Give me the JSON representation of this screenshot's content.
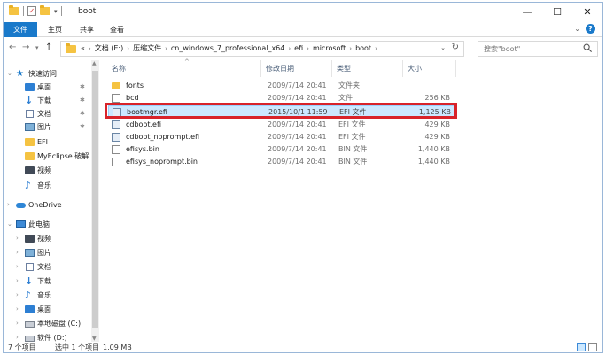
{
  "window": {
    "title": "boot",
    "controls": {
      "minimize": "—",
      "maximize": "☐",
      "close": "✕"
    }
  },
  "ribbon": {
    "tabs": [
      "文件",
      "主页",
      "共享",
      "查看"
    ]
  },
  "address": {
    "prefix": "«",
    "crumbs": [
      "文档 (E:)",
      "压缩文件",
      "cn_windows_7_professional_x64",
      "efi",
      "microsoft",
      "boot"
    ],
    "search_placeholder": "搜索\"boot\""
  },
  "nav": {
    "items": [
      {
        "label": "快速访问",
        "icon": "star-icon",
        "pinned": false
      },
      {
        "label": "桌面",
        "icon": "desktop-icon",
        "pinned": true
      },
      {
        "label": "下载",
        "icon": "download-icon",
        "pinned": true
      },
      {
        "label": "文档",
        "icon": "document-icon",
        "pinned": true
      },
      {
        "label": "图片",
        "icon": "picture-icon",
        "pinned": true
      },
      {
        "label": "EFI",
        "icon": "folder-icon",
        "pinned": false
      },
      {
        "label": "MyEclipse 破解",
        "icon": "folder-icon",
        "pinned": false
      },
      {
        "label": "视频",
        "icon": "video-icon",
        "pinned": false
      },
      {
        "label": "音乐",
        "icon": "music-icon",
        "pinned": false
      },
      {
        "label": "OneDrive",
        "icon": "cloud-icon",
        "pinned": false
      },
      {
        "label": "此电脑",
        "icon": "computer-icon",
        "pinned": false
      },
      {
        "label": "视频",
        "icon": "video-icon",
        "pinned": false
      },
      {
        "label": "图片",
        "icon": "picture-icon",
        "pinned": false
      },
      {
        "label": "文档",
        "icon": "document-icon",
        "pinned": false
      },
      {
        "label": "下载",
        "icon": "download-icon",
        "pinned": false
      },
      {
        "label": "音乐",
        "icon": "music-icon",
        "pinned": false
      },
      {
        "label": "桌面",
        "icon": "desktop-icon",
        "pinned": false
      },
      {
        "label": "本地磁盘 (C:)",
        "icon": "drive-icon",
        "pinned": false
      },
      {
        "label": "软件 (D:)",
        "icon": "drive-icon",
        "pinned": false
      }
    ]
  },
  "columns": {
    "name": "名称",
    "date": "修改日期",
    "type": "类型",
    "size": "大小"
  },
  "files": [
    {
      "name": "fonts",
      "date": "2009/7/14 20:41",
      "type": "文件夹",
      "size": "",
      "icon": "folder-icon",
      "selected": false
    },
    {
      "name": "bcd",
      "date": "2009/7/14 20:41",
      "type": "文件",
      "size": "256 KB",
      "icon": "file-icon",
      "selected": false
    },
    {
      "name": "bootmgr.efi",
      "date": "2015/10/1 11:59",
      "type": "EFI 文件",
      "size": "1,125 KB",
      "icon": "efi-file-icon",
      "selected": true
    },
    {
      "name": "cdboot.efi",
      "date": "2009/7/14 20:41",
      "type": "EFI 文件",
      "size": "429 KB",
      "icon": "efi-file-icon",
      "selected": false
    },
    {
      "name": "cdboot_noprompt.efi",
      "date": "2009/7/14 20:41",
      "type": "EFI 文件",
      "size": "429 KB",
      "icon": "efi-file-icon",
      "selected": false
    },
    {
      "name": "efisys.bin",
      "date": "2009/7/14 20:41",
      "type": "BIN 文件",
      "size": "1,440 KB",
      "icon": "file-icon",
      "selected": false
    },
    {
      "name": "efisys_noprompt.bin",
      "date": "2009/7/14 20:41",
      "type": "BIN 文件",
      "size": "1,440 KB",
      "icon": "file-icon",
      "selected": false
    }
  ],
  "status": {
    "count": "7 个项目",
    "selected": "选中 1 个项目",
    "size": "1.09 MB"
  },
  "colors": {
    "accent": "#1979ca",
    "selection": "#cce8ff",
    "highlight_box": "#d8232a"
  }
}
